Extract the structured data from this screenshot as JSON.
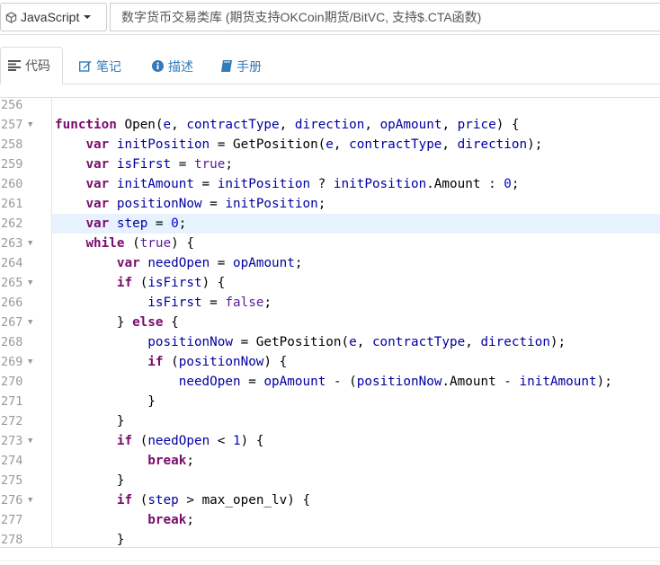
{
  "toolbar": {
    "language_label": "JavaScript",
    "language_icon": "cube-icon",
    "title_value": "数字货币交易类库 (期货支持OKCoin期货/BitVC, 支持$.CTA函数)"
  },
  "tabs": [
    {
      "label": "代码",
      "icon": "align-left-icon",
      "active": true
    },
    {
      "label": "笔记",
      "icon": "edit-icon",
      "active": false
    },
    {
      "label": "描述",
      "icon": "info-circle-icon",
      "active": false
    },
    {
      "label": "手册",
      "icon": "book-icon",
      "active": false
    }
  ],
  "editor": {
    "highlight_color": "#e8f2fe",
    "lines": [
      {
        "n": "256",
        "fold": false,
        "text": ""
      },
      {
        "n": "257",
        "fold": true,
        "text": "function Open(e, contractType, direction, opAmount, price) {"
      },
      {
        "n": "258",
        "fold": false,
        "text": "    var initPosition = GetPosition(e, contractType, direction);"
      },
      {
        "n": "259",
        "fold": false,
        "text": "    var isFirst = true;"
      },
      {
        "n": "260",
        "fold": false,
        "text": "    var initAmount = initPosition ? initPosition.Amount : 0;"
      },
      {
        "n": "261",
        "fold": false,
        "text": "    var positionNow = initPosition;"
      },
      {
        "n": "262",
        "fold": false,
        "text": "    var step = 0;",
        "highlight": true
      },
      {
        "n": "263",
        "fold": true,
        "text": "    while (true) {"
      },
      {
        "n": "264",
        "fold": false,
        "text": "        var needOpen = opAmount;"
      },
      {
        "n": "265",
        "fold": true,
        "text": "        if (isFirst) {"
      },
      {
        "n": "266",
        "fold": false,
        "text": "            isFirst = false;"
      },
      {
        "n": "267",
        "fold": true,
        "text": "        } else {"
      },
      {
        "n": "268",
        "fold": false,
        "text": "            positionNow = GetPosition(e, contractType, direction);"
      },
      {
        "n": "269",
        "fold": true,
        "text": "            if (positionNow) {"
      },
      {
        "n": "270",
        "fold": false,
        "text": "                needOpen = opAmount - (positionNow.Amount - initAmount);"
      },
      {
        "n": "271",
        "fold": false,
        "text": "            }"
      },
      {
        "n": "272",
        "fold": false,
        "text": "        }"
      },
      {
        "n": "273",
        "fold": true,
        "text": "        if (needOpen < 1) {"
      },
      {
        "n": "274",
        "fold": false,
        "text": "            break;"
      },
      {
        "n": "275",
        "fold": false,
        "text": "        }"
      },
      {
        "n": "276",
        "fold": true,
        "text": "        if (step > max_open_lv) {"
      },
      {
        "n": "277",
        "fold": false,
        "text": "            break;"
      },
      {
        "n": "278",
        "fold": false,
        "text": "        }"
      }
    ]
  }
}
